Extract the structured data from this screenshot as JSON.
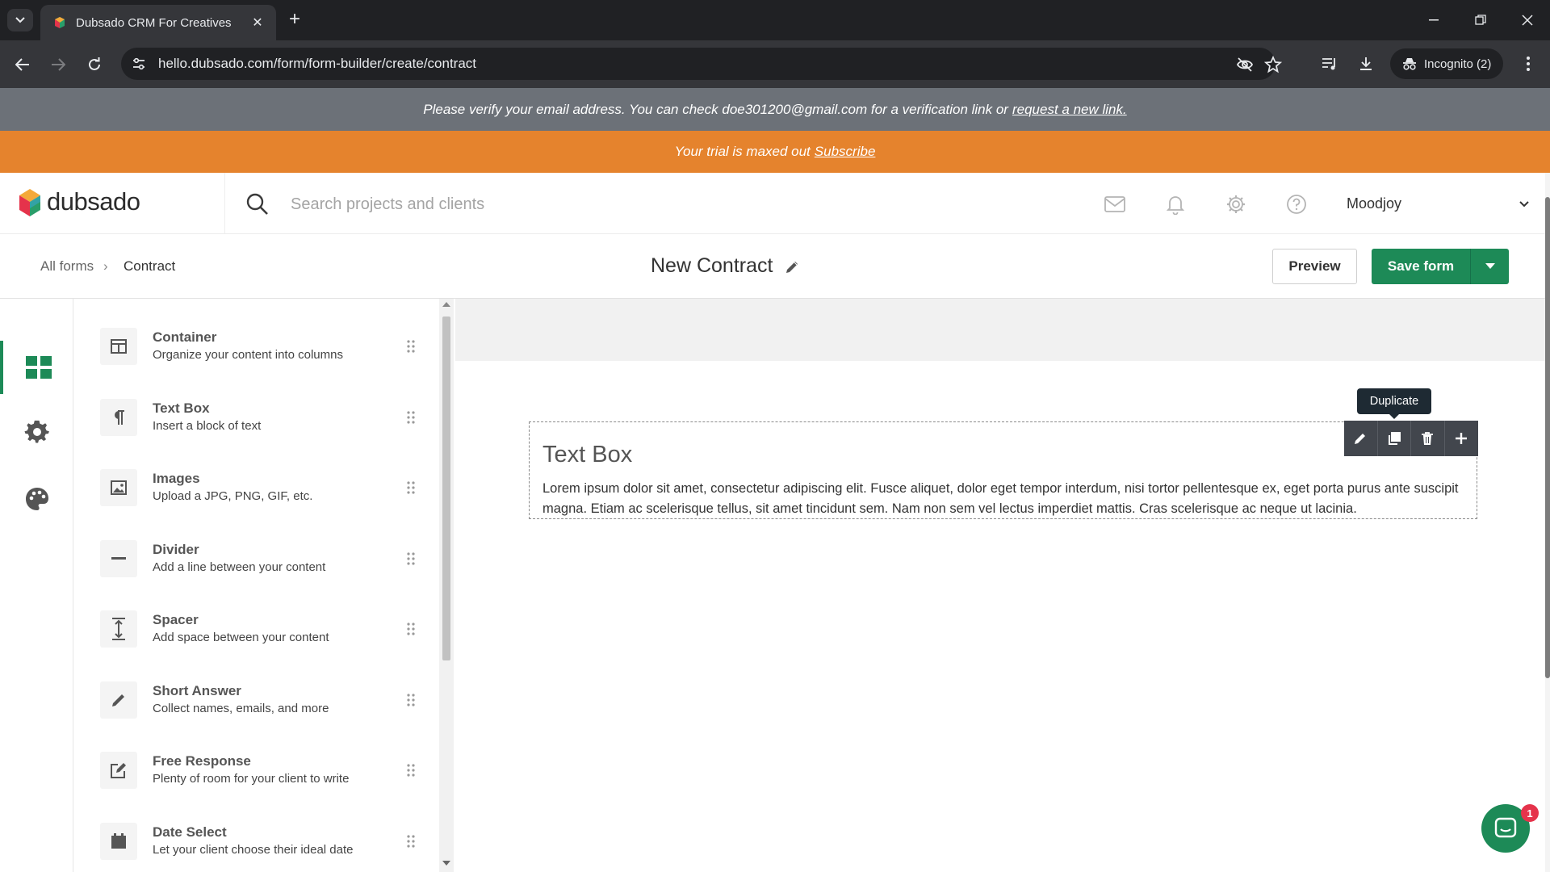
{
  "browser": {
    "tab_title": "Dubsado CRM For Creatives",
    "url": "hello.dubsado.com/form/form-builder/create/contract",
    "incognito_label": "Incognito (2)"
  },
  "banners": {
    "verify_text": "Please verify your email address. You can check doe301200@gmail.com for a verification link or",
    "verify_link": "request a new link.",
    "trial_text": "Your trial is maxed out",
    "trial_link": "Subscribe"
  },
  "header": {
    "logo_text": "dubsado",
    "search_placeholder": "Search projects and clients",
    "user_name": "Moodjoy"
  },
  "subheader": {
    "breadcrumb_all": "All forms",
    "breadcrumb_separator": "›",
    "breadcrumb_current": "Contract",
    "form_title": "New Contract",
    "preview_label": "Preview",
    "save_label": "Save form"
  },
  "elements": [
    {
      "title": "Container",
      "desc": "Organize your content into columns",
      "icon": "container-icon"
    },
    {
      "title": "Text Box",
      "desc": "Insert a block of text",
      "icon": "paragraph-icon"
    },
    {
      "title": "Images",
      "desc": "Upload a JPG, PNG, GIF, etc.",
      "icon": "image-icon"
    },
    {
      "title": "Divider",
      "desc": "Add a line between your content",
      "icon": "divider-icon"
    },
    {
      "title": "Spacer",
      "desc": "Add space between your content",
      "icon": "spacer-icon"
    },
    {
      "title": "Short Answer",
      "desc": "Collect names, emails, and more",
      "icon": "pencil-icon"
    },
    {
      "title": "Free Response",
      "desc": "Plenty of room for your client to write",
      "icon": "edit-box-icon"
    },
    {
      "title": "Date Select",
      "desc": "Let your client choose their ideal date",
      "icon": "calendar-icon"
    }
  ],
  "canvas": {
    "textbox_heading": "Text Box",
    "textbox_body": "Lorem ipsum dolor sit amet, consectetur adipiscing elit. Fusce aliquet, dolor eget tempor interdum, nisi tortor pellentesque ex, eget porta purus ante suscipit magna. Etiam ac scelerisque tellus, sit amet tincidunt sem. Nam non sem vel lectus imperdiet mattis. Cras scelerisque ac neque ut lacinia.",
    "tooltip": "Duplicate"
  },
  "chat": {
    "badge_count": "1"
  },
  "colors": {
    "brand_green": "#1d8a57",
    "trial_orange": "#e5832d",
    "verify_gray": "#6c7178"
  }
}
